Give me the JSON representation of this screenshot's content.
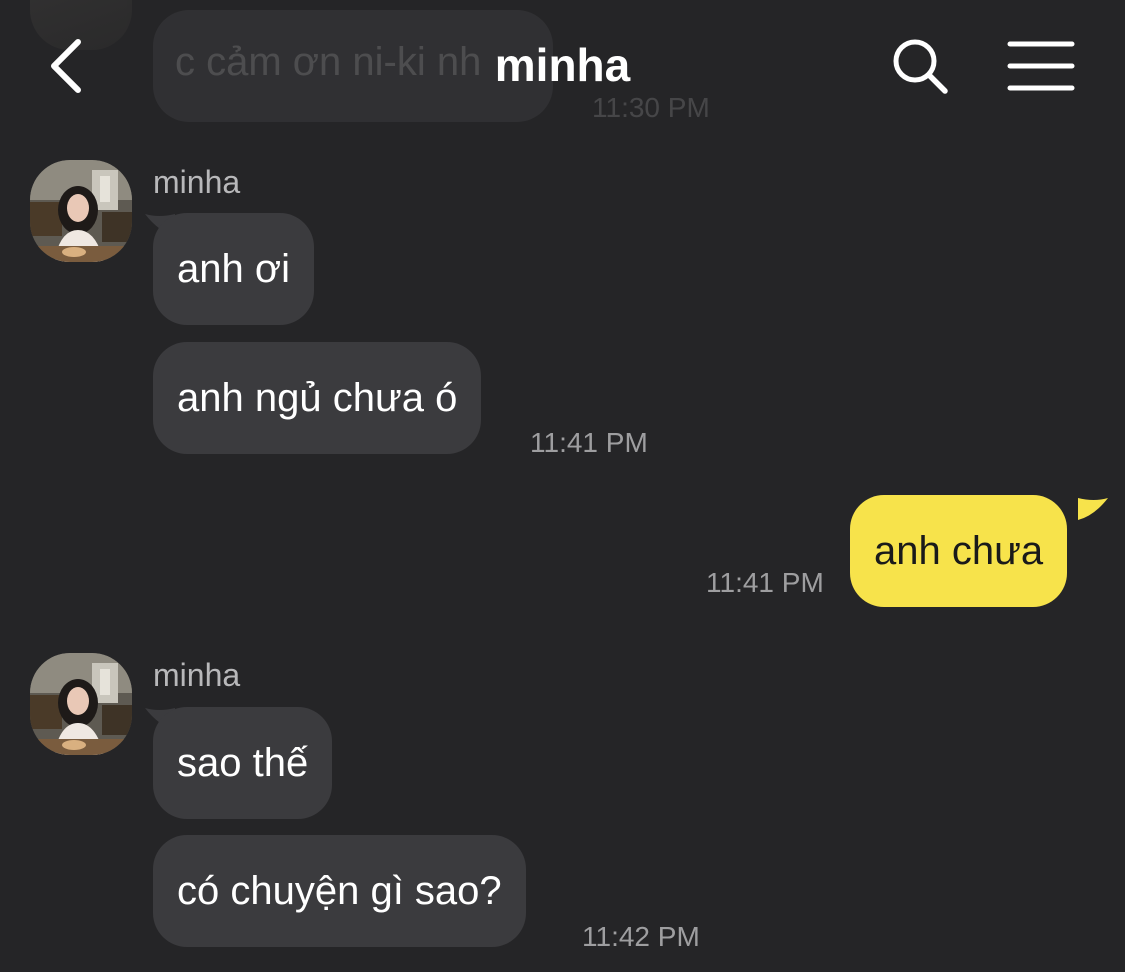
{
  "header": {
    "title": "minha",
    "back_icon": "chevron-left-icon",
    "search_icon": "search-icon",
    "menu_icon": "hamburger-menu-icon",
    "previous_message": {
      "text": "c cảm ơn ni-ki nh",
      "time": "11:30 PM"
    }
  },
  "messages": [
    {
      "group": 1,
      "sender": "minha",
      "bubbles": [
        "anh ơi",
        "anh ngủ chưa ó"
      ],
      "time": "11:41 PM"
    },
    {
      "group": 2,
      "sender": "me",
      "bubbles": [
        "anh chưa"
      ],
      "time": "11:41 PM"
    },
    {
      "group": 3,
      "sender": "minha",
      "bubbles": [
        "sao thế",
        "có chuyện gì sao?"
      ],
      "time": "11:42 PM"
    }
  ],
  "colors": {
    "background": "#252527",
    "incoming_bubble": "#3b3b3e",
    "outgoing_bubble": "#f7e34b",
    "timestamp": "#9e9ea0",
    "sender_name": "#b8b8ba"
  }
}
